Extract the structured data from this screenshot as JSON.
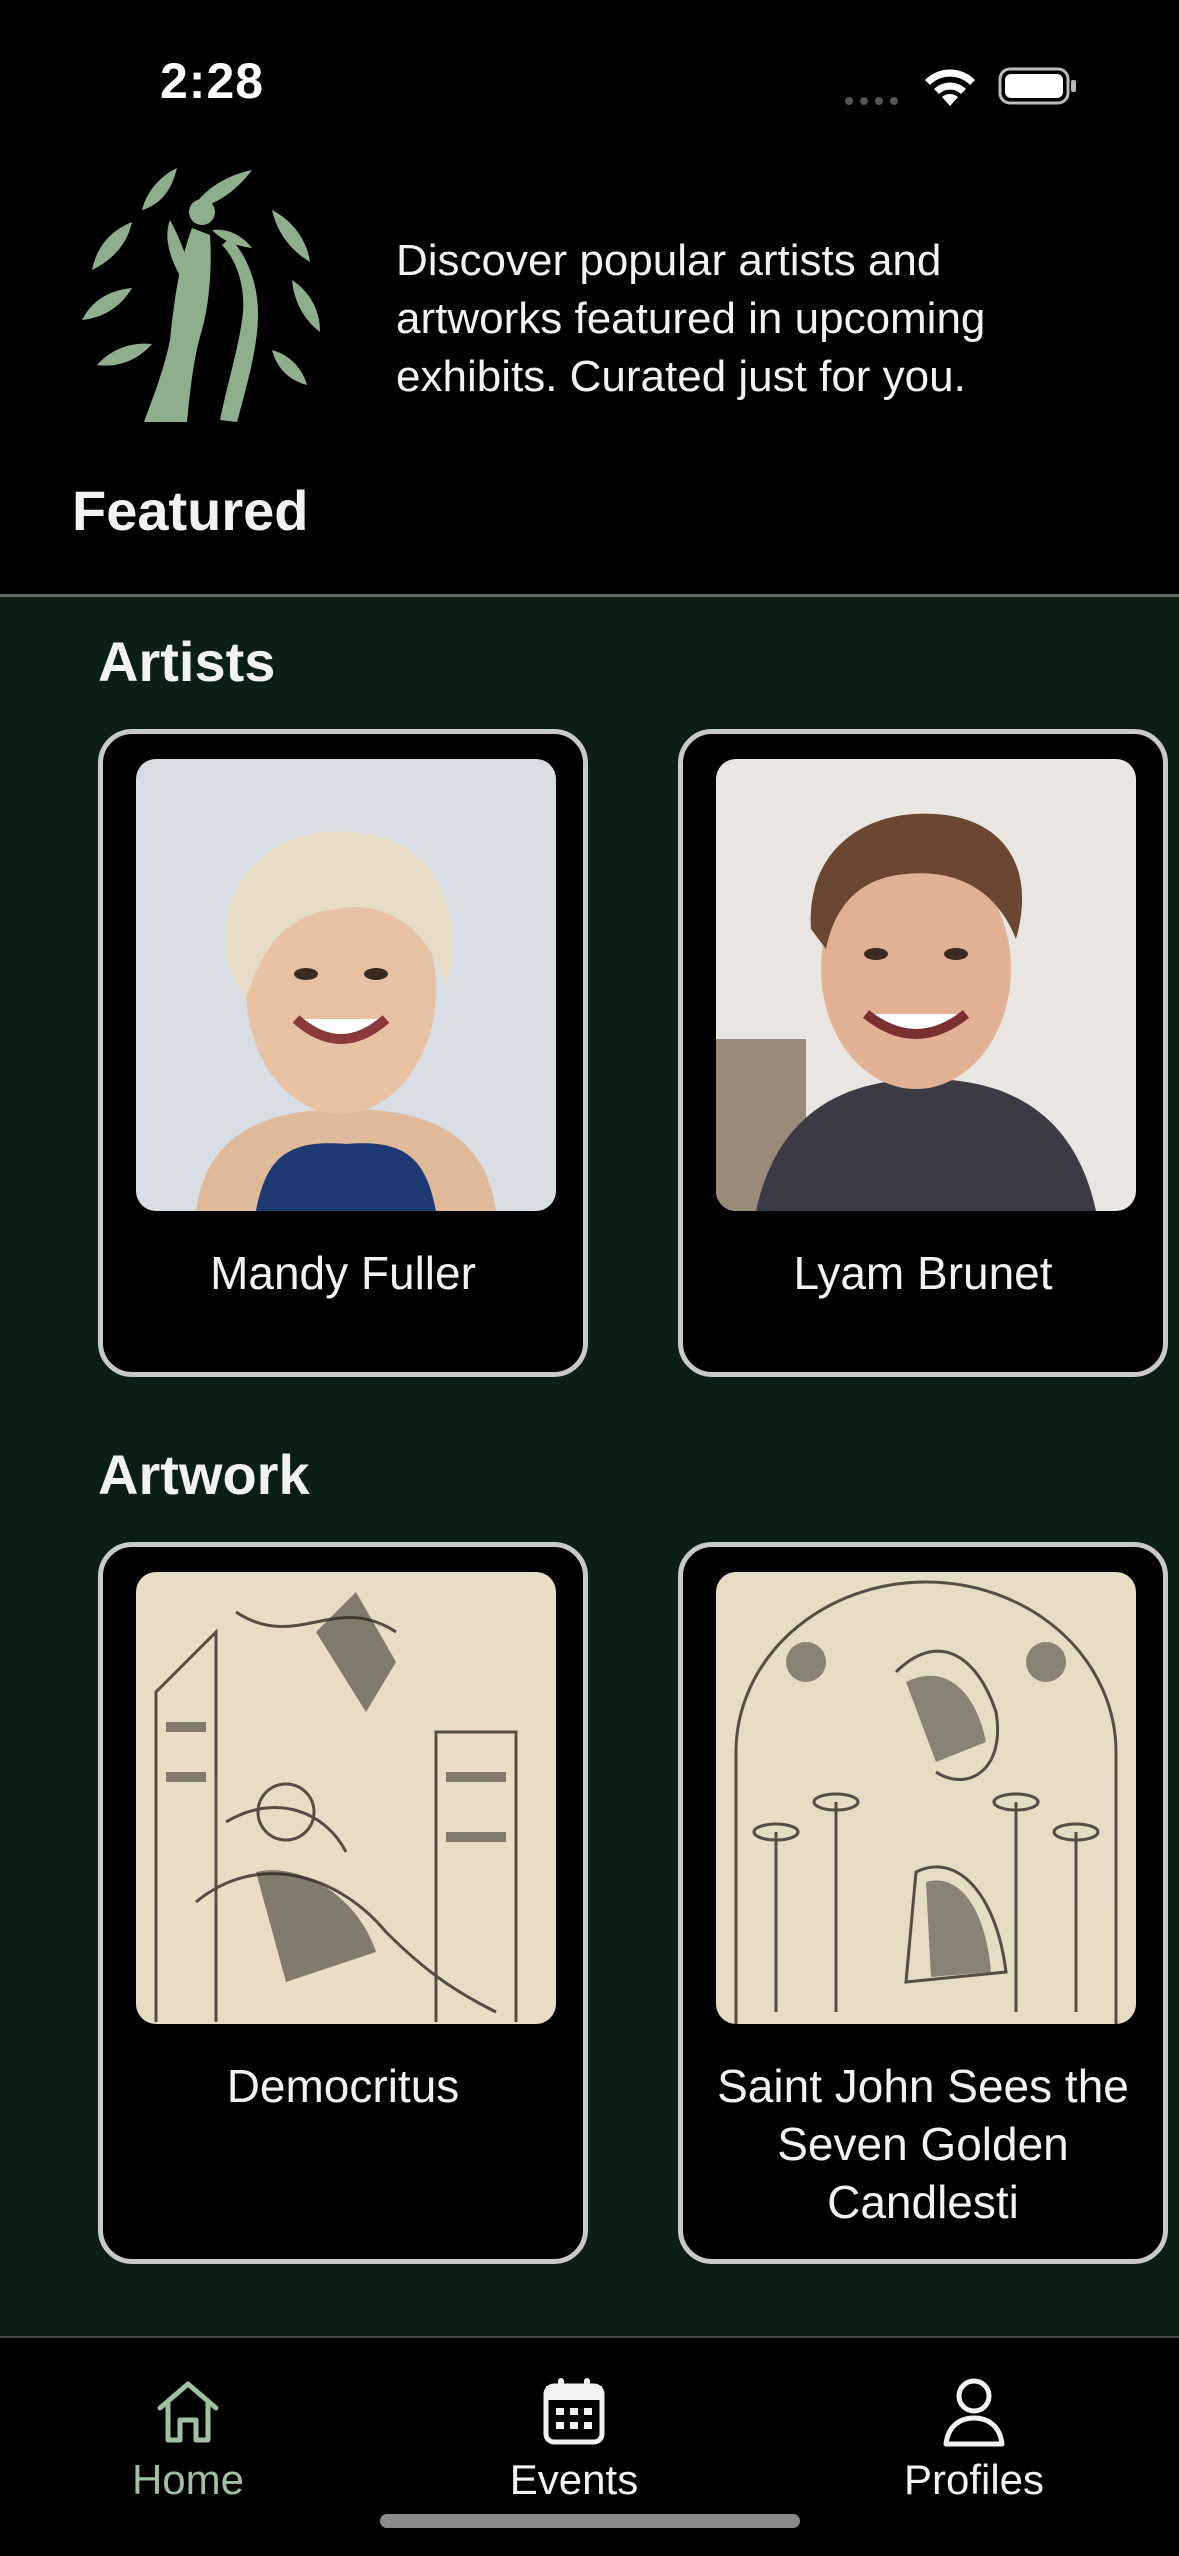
{
  "status_bar": {
    "time": "2:28"
  },
  "header": {
    "tagline": "Discover popular artists and artworks featured in upcoming exhibits. Curated just for you.",
    "title": "Featured"
  },
  "sections": {
    "artists": {
      "title": "Artists",
      "items": [
        {
          "name": "Mandy Fuller"
        },
        {
          "name": "Lyam Brunet"
        }
      ]
    },
    "artwork": {
      "title": "Artwork",
      "items": [
        {
          "name": "Democritus"
        },
        {
          "name": "Saint John Sees the Seven Golden Candlesti"
        }
      ]
    }
  },
  "tab_bar": {
    "tabs": [
      {
        "label": "Home",
        "icon": "home-icon",
        "active": true
      },
      {
        "label": "Events",
        "icon": "calendar-icon",
        "active": false
      },
      {
        "label": "Profiles",
        "icon": "person-icon",
        "active": false
      }
    ]
  },
  "colors": {
    "accent_active": "#9fc1a0",
    "content_bg": "#0b1f15",
    "card_border": "#c9c9c9",
    "inactive_tab": "#f2f2f2"
  }
}
